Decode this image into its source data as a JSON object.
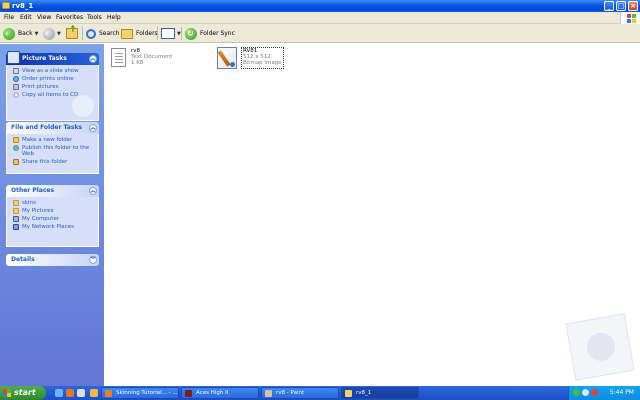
{
  "window": {
    "title": "rv8_1"
  },
  "menu": [
    "File",
    "Edit",
    "View",
    "Favorites",
    "Tools",
    "Help"
  ],
  "toolbar": {
    "back": "Back",
    "search": "Search",
    "folders": "Folders",
    "folder_sync": "Folder Sync"
  },
  "sidebar": {
    "picture_tasks": {
      "title": "Picture Tasks",
      "items": [
        "View as a slide show",
        "Order prints online",
        "Print pictures",
        "Copy all items to CD"
      ]
    },
    "file_folder_tasks": {
      "title": "File and Folder Tasks",
      "items": [
        "Make a new folder",
        "Publish this folder to the Web",
        "Share this folder"
      ]
    },
    "other_places": {
      "title": "Other Places",
      "items": [
        "skins",
        "My Pictures",
        "My Computer",
        "My Network Places"
      ]
    },
    "details": {
      "title": "Details"
    }
  },
  "files": [
    {
      "name": "rv8",
      "type": "Text Document",
      "size": "1 KB"
    },
    {
      "name": "RV81",
      "dimensions": "512 x 512",
      "type": "Bitmap Image"
    }
  ],
  "taskbar": {
    "start": "start",
    "tasks": [
      "Skinning Tutorial... - ...",
      "Aces High II",
      "rv8 - Paint",
      "rv8_1"
    ],
    "clock": "5:44 PM"
  }
}
